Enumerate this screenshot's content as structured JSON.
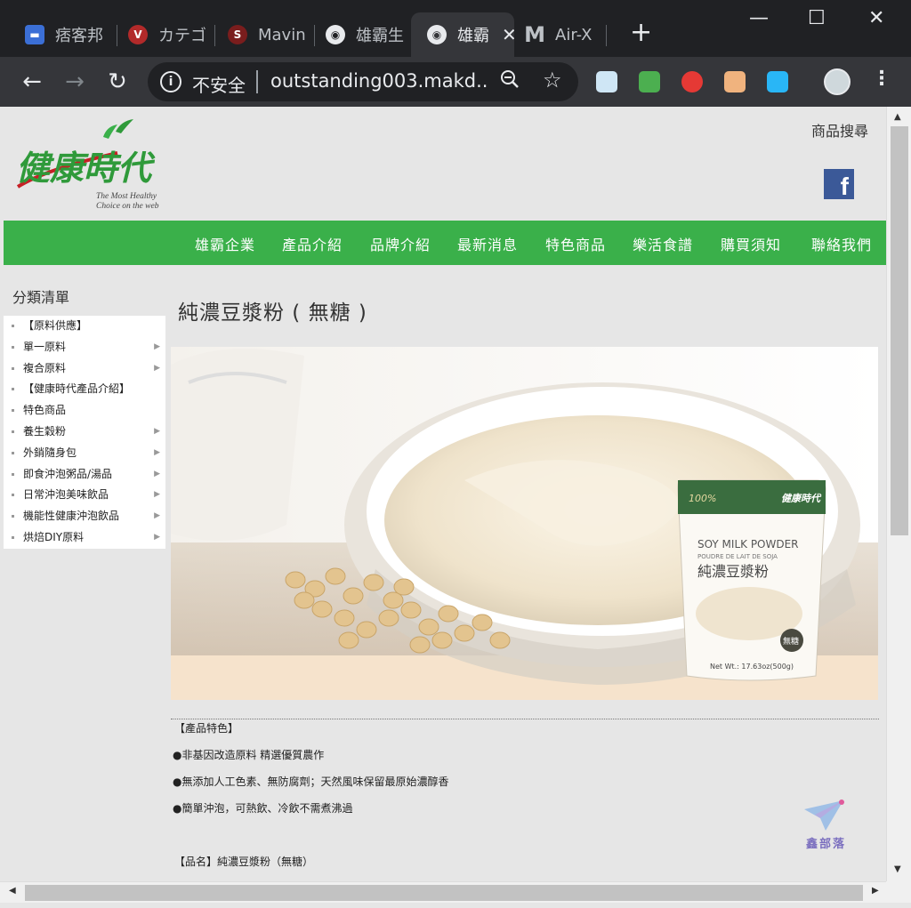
{
  "browser": {
    "tabs": [
      {
        "title": "痞客邦",
        "icon": "chat-icon"
      },
      {
        "title": "カテゴ",
        "icon": "vcp-icon"
      },
      {
        "title": "Mavin",
        "icon": "s-icon"
      },
      {
        "title": "雄霸生",
        "icon": "globe-icon"
      },
      {
        "title": "雄霸",
        "icon": "globe-icon"
      },
      {
        "title": "Air-X",
        "icon": "m-icon"
      }
    ],
    "new_tab": "+",
    "minimize": "—",
    "maximize": "☐",
    "close": "✕",
    "back": "←",
    "forward": "→",
    "reload": "↻",
    "security_label": "不安全",
    "url": "outstanding003.makd...",
    "menu": "⋮"
  },
  "site": {
    "logo_text": "健康時代",
    "slogan_line1": "The Most Healthy",
    "slogan_line2": "Choice on the web",
    "search_link": "商品搜尋",
    "facebook": "f",
    "nav": [
      "雄霸企業",
      "產品介紹",
      "品牌介紹",
      "最新消息",
      "特色商品",
      "樂活食譜",
      "購買須知",
      "聯絡我們"
    ],
    "sidebar_title": "分類清單",
    "sidebar": [
      {
        "label": "【原料供應】",
        "arrow": false
      },
      {
        "label": "單一原料",
        "arrow": true
      },
      {
        "label": "複合原料",
        "arrow": true
      },
      {
        "label": "【健康時代產品介紹】",
        "arrow": false
      },
      {
        "label": "特色商品",
        "arrow": false
      },
      {
        "label": "養生穀粉",
        "arrow": true
      },
      {
        "label": "外銷隨身包",
        "arrow": true
      },
      {
        "label": "即食沖泡粥品/湯品",
        "arrow": true
      },
      {
        "label": "日常沖泡美味飲品",
        "arrow": true
      },
      {
        "label": "機能性健康沖泡飲品",
        "arrow": true
      },
      {
        "label": "烘焙DIY原料",
        "arrow": true
      }
    ],
    "arrow_glyph": "▶",
    "product_title": "純濃豆漿粉 ( 無糖 )",
    "package": {
      "brand": "健康時代",
      "line_en1": "SOY MILK POWDER",
      "line_fr": "POUDRE DE LAIT DE SOJA",
      "line_zh": "純濃豆漿粉",
      "badge": "100%",
      "tag": "無糖",
      "net_wt": "Net Wt.: 17.63oz(500g)"
    },
    "features_heading": "【產品特色】",
    "features": [
      "●非基因改造原料 精選優質農作",
      "●無添加人工色素、無防腐劑；天然風味保留最原始濃醇香",
      "●簡單沖泡，可熱飲、冷飲不需煮沸過"
    ],
    "product_name_line": "【品名】純濃豆漿粉（無糖）",
    "watermark": "鑫部落"
  },
  "colors": {
    "nav_green": "#3ab04a",
    "logo_green": "#2f9a3a",
    "logo_red": "#c62026",
    "fb_blue": "#3b5998"
  }
}
